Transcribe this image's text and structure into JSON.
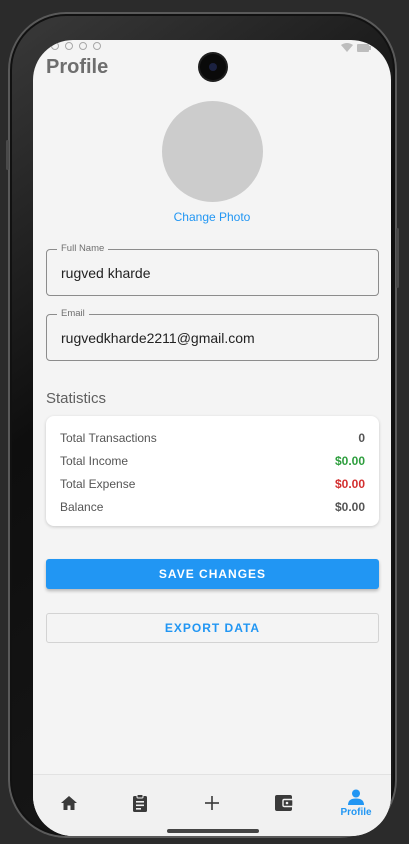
{
  "page": {
    "title": "Profile"
  },
  "profile": {
    "change_photo_label": "Change Photo"
  },
  "form": {
    "full_name": {
      "label": "Full Name",
      "value": "rugved kharde"
    },
    "email": {
      "label": "Email",
      "value": "rugvedkharde2211@gmail.com"
    }
  },
  "statistics": {
    "title": "Statistics",
    "rows": [
      {
        "label": "Total Transactions",
        "value": "0",
        "color": "#555555"
      },
      {
        "label": "Total Income",
        "value": "$0.00",
        "color": "#2e9e3e"
      },
      {
        "label": "Total Expense",
        "value": "$0.00",
        "color": "#d32f2f"
      },
      {
        "label": "Balance",
        "value": "$0.00",
        "color": "#555555"
      }
    ]
  },
  "actions": {
    "save_label": "SAVE CHANGES",
    "export_label": "EXPORT DATA"
  },
  "bottom_nav": {
    "items": [
      {
        "icon": "home-icon",
        "label": ""
      },
      {
        "icon": "clipboard-icon",
        "label": ""
      },
      {
        "icon": "add-icon",
        "label": ""
      },
      {
        "icon": "wallet-icon",
        "label": ""
      },
      {
        "icon": "person-icon",
        "label": "Profile",
        "active": true
      }
    ]
  },
  "colors": {
    "accent": "#2196f3",
    "income": "#2e9e3e",
    "expense": "#d32f2f",
    "background": "#f4f4f4"
  }
}
